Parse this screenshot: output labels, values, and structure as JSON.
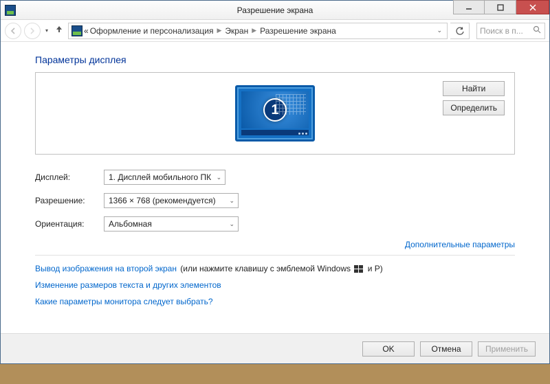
{
  "titlebar": {
    "title": "Разрешение экрана"
  },
  "breadcrumb": {
    "prefix": "«",
    "part1": "Оформление и персонализация",
    "part2": "Экран",
    "part3": "Разрешение экрана"
  },
  "search": {
    "placeholder": "Поиск в п..."
  },
  "heading": "Параметры дисплея",
  "display_preview": {
    "number": "1"
  },
  "side_buttons": {
    "find": "Найти",
    "identify": "Определить"
  },
  "form": {
    "display_label": "Дисплей:",
    "display_value": "1. Дисплей мобильного ПК",
    "resolution_label": "Разрешение:",
    "resolution_value": "1366 × 768 (рекомендуется)",
    "orientation_label": "Ориентация:",
    "orientation_value": "Альбомная"
  },
  "links": {
    "advanced": "Дополнительные параметры",
    "project_link": "Вывод изображения на второй экран",
    "project_suffix_a": " (или нажмите клавишу с эмблемой Windows ",
    "project_suffix_b": " и P)",
    "text_size": "Изменение размеров текста и других элементов",
    "which_settings": "Какие параметры монитора следует выбрать?"
  },
  "footer": {
    "ok": "OK",
    "cancel": "Отмена",
    "apply": "Применить"
  }
}
